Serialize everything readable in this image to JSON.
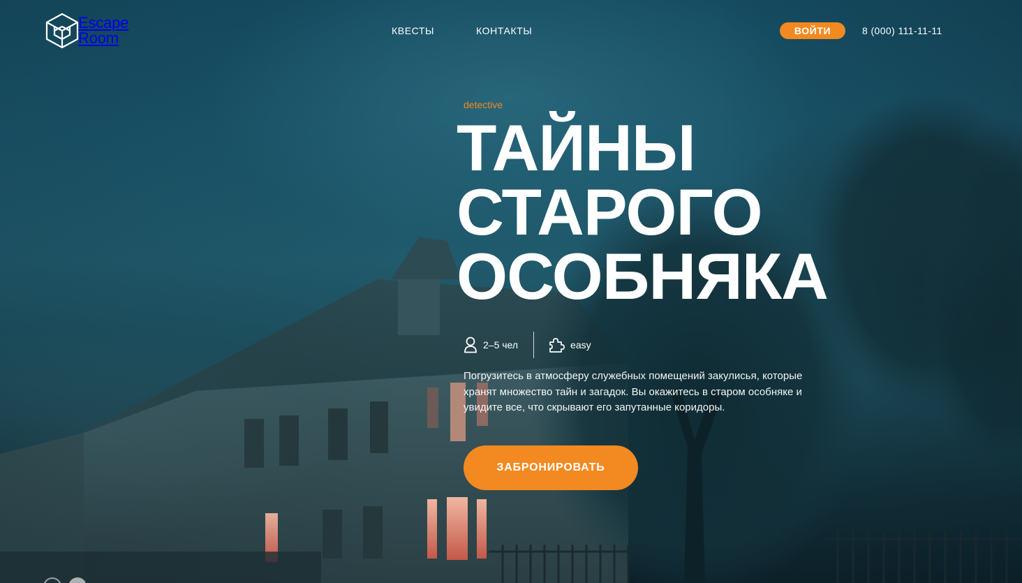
{
  "logo": {
    "line1": "Escape",
    "line2": "Room"
  },
  "nav": {
    "quests": "КВЕСТЫ",
    "contacts": "КОНТАКТЫ"
  },
  "header": {
    "login_label": "ВОЙТИ",
    "phone": "8 (000) 111-11-11"
  },
  "quest": {
    "genre": "detective",
    "title_lines": [
      "ТАЙНЫ",
      "СТАРОГО",
      "ОСОБНЯКА"
    ],
    "players": "2–5 чел",
    "level": "easy",
    "description": "Погрузитесь в атмосферу служебных помещений закулисья, которые хранят множество тайн и загадок. Вы окажитесь в старом особняке и увидите все, что скрывают его запутанные коридоры.",
    "book_label": "ЗАБРОНИРОВАТЬ"
  },
  "colors": {
    "accent": "#f28a21",
    "text": "#ffffff",
    "background": "#1a5469"
  },
  "icons": {
    "logo": "cube-logo-icon",
    "players": "person-icon",
    "level": "puzzle-piece-icon"
  }
}
